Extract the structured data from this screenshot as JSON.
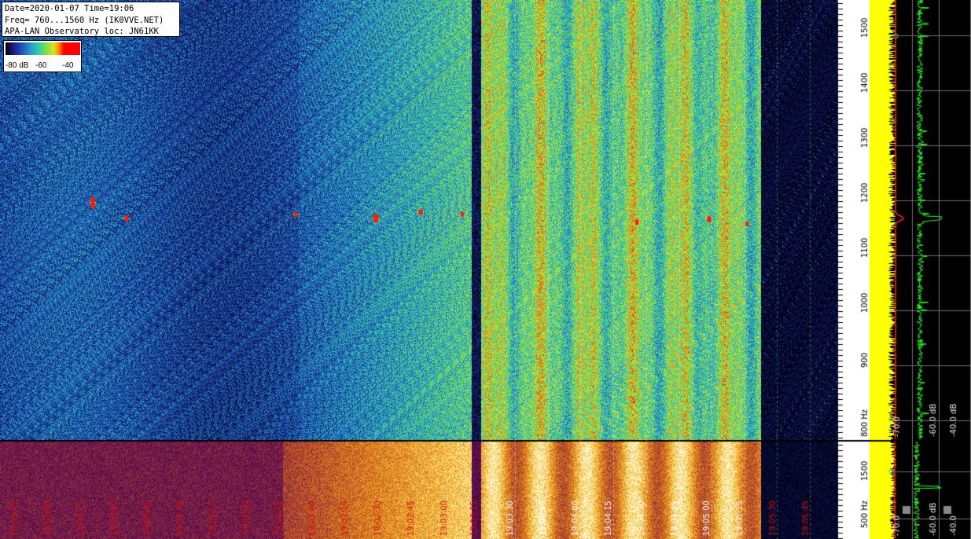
{
  "info_box": {
    "line1": "Date=2020-01-07 Time=19:06",
    "line2": "Freq= 760...1560 Hz (IK0VVE.NET)",
    "line3": "APA-LAN Observatory loc: JN61KK"
  },
  "colorbar": {
    "labels": [
      "-80 dB",
      "-60",
      "-40"
    ]
  },
  "freq_axis": {
    "ticks": [
      "1500",
      "1400",
      "1300",
      "1200",
      "1100",
      "1000",
      "900",
      "800 Hz"
    ]
  },
  "lower_freq_axis": {
    "ticks": [
      "1500",
      "500 Hz"
    ]
  },
  "spectrum_axis": {
    "upper": [
      "-70.0",
      "-60.0 dB",
      "-40.0 dB"
    ],
    "lower": [
      "-70.0",
      "-60.0 dB",
      "-40.0"
    ]
  },
  "time_labels": [
    "19:03:30",
    "19:03:45",
    "19:04:00",
    "19:04:15",
    "19:04:30",
    "19:04:45",
    "19:05:00",
    "19:05:15",
    "19:05:30",
    "19:05:45"
  ],
  "early_time_labels": [
    "18:59:45",
    "19:00:00",
    "19:00:15",
    "19:00:30",
    "19:00:45",
    "19:01:00",
    "19:01:15",
    "19:01:30",
    "19:01:45",
    "19:02:00",
    "19:02:15",
    "19:02:30",
    "19:02:45",
    "19:03:00",
    "19:03:15"
  ],
  "colors": {
    "trace_red": "#ff2020",
    "trace_green": "#20ff20",
    "trace_yellow": "#ffff00",
    "time_label_white": "#ffffff",
    "time_label_red": "#d01010"
  }
}
